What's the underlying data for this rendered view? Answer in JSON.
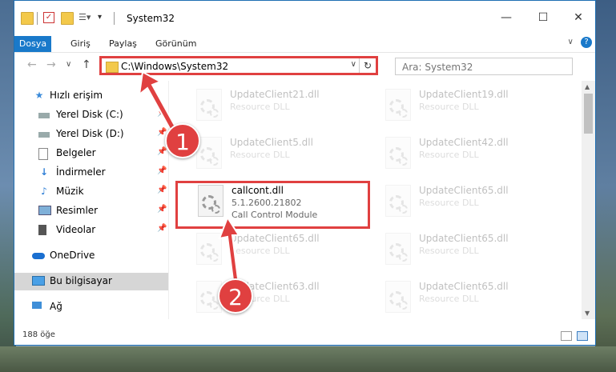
{
  "window": {
    "title": "System32",
    "controls": {
      "minimize": "—",
      "maximize": "☐",
      "close": "✕"
    }
  },
  "ribbon": {
    "tabs": [
      "Dosya",
      "Giriş",
      "Paylaş",
      "Görünüm"
    ],
    "expand": "∨",
    "help": "?"
  },
  "address": {
    "path": "C:\\Windows\\System32",
    "dropdown": "∨",
    "refresh": "↻",
    "back": "←",
    "forward": "→",
    "recent": "∨",
    "up": "↑"
  },
  "search": {
    "placeholder": "Ara: System32"
  },
  "nav_pane": {
    "items": [
      {
        "label": "Hızlı erişim",
        "icon": "star-icon"
      },
      {
        "label": "Yerel Disk (C:)",
        "icon": "drive-icon",
        "pinned": true
      },
      {
        "label": "Yerel Disk (D:)",
        "icon": "drive-icon",
        "pinned": true
      },
      {
        "label": "Belgeler",
        "icon": "document-icon",
        "pinned": true
      },
      {
        "label": "İndirmeler",
        "icon": "download-icon",
        "pinned": true
      },
      {
        "label": "Müzik",
        "icon": "music-icon",
        "pinned": true
      },
      {
        "label": "Resimler",
        "icon": "pictures-icon",
        "pinned": true
      },
      {
        "label": "Videolar",
        "icon": "video-icon",
        "pinned": true
      },
      {
        "label": "OneDrive",
        "icon": "cloud-icon"
      },
      {
        "label": "Bu bilgisayar",
        "icon": "computer-icon",
        "selected": true
      },
      {
        "label": "Ağ",
        "icon": "network-icon"
      }
    ]
  },
  "files": [
    {
      "name": "UpdateClient21.dll",
      "desc": "Resource DLL"
    },
    {
      "name": "UpdateClient19.dll",
      "desc": "Resource DLL"
    },
    {
      "name": "UpdateClient5.dll",
      "desc": "Resource DLL"
    },
    {
      "name": "UpdateClient42.dll",
      "desc": "Resource DLL"
    },
    {
      "name": "callcont.dll",
      "version": "5.1.2600.21802",
      "desc": "Call Control Module"
    },
    {
      "name": "UpdateClient65.dll",
      "desc": "Resource DLL"
    },
    {
      "name": "UpdateClient65.dll",
      "desc": "Resource DLL"
    },
    {
      "name": "UpdateClient65.dll",
      "desc": "Resource DLL"
    },
    {
      "name": "UpdateClient63.dll",
      "desc": "Resource DLL"
    },
    {
      "name": "UpdateClient65.dll",
      "desc": "Resource DLL"
    }
  ],
  "status": {
    "count": "188 öğe"
  },
  "annotations": {
    "badge1": "1",
    "badge2": "2"
  },
  "colors": {
    "accent": "#1979ca",
    "highlight": "#e04040"
  }
}
